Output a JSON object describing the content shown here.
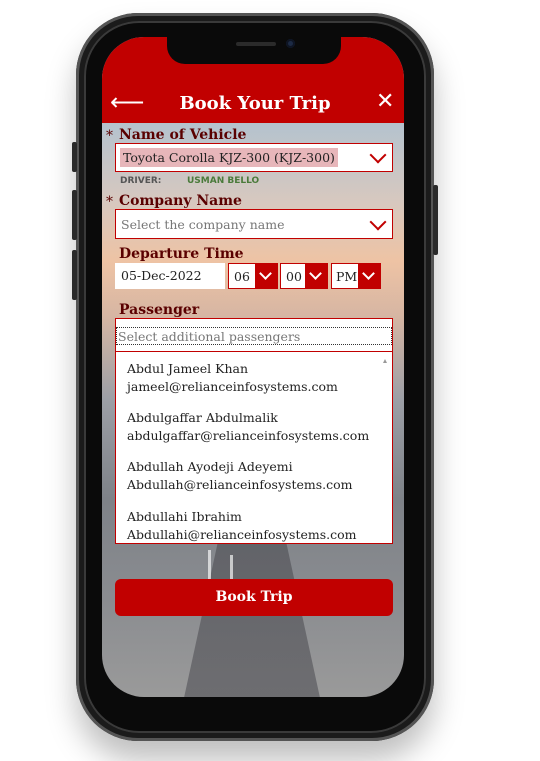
{
  "header": {
    "title": "Book Your Trip",
    "back_icon": "arrow-left-icon",
    "close_icon": "close-icon"
  },
  "vehicle": {
    "label": "Name of  Vehicle",
    "required_mark": "*",
    "value": "Toyota Corolla KJZ-300 (KJZ-300)",
    "driver_label": "DRIVER:",
    "driver_name": "USMAN BELLO"
  },
  "company": {
    "label": "Company Name",
    "required_mark": "*",
    "placeholder": "Select the company name"
  },
  "departure": {
    "label": "Departure Time",
    "date": "05-Dec-2022",
    "hour": "06",
    "minute": "00",
    "ampm": "PM"
  },
  "passenger": {
    "label": "Passenger",
    "placeholder": "Select additional passengers",
    "options": [
      {
        "name": "Abdul Jameel Khan",
        "email": "jameel@relianceinfosystems.com"
      },
      {
        "name": "Abdulgaffar Abdulmalik",
        "email": "abdulgaffar@relianceinfosystems.com"
      },
      {
        "name": "Abdullah Ayodeji Adeyemi",
        "email": "Abdullah@relianceinfosystems.com"
      },
      {
        "name": "Abdullahi Ibrahim",
        "email": "Abdullahi@relianceinfosystems.com"
      }
    ]
  },
  "actions": {
    "book_label": "Book Trip"
  },
  "colors": {
    "brand": "#c10000",
    "label": "#5a0000",
    "driver_name": "#4a7a3a"
  }
}
